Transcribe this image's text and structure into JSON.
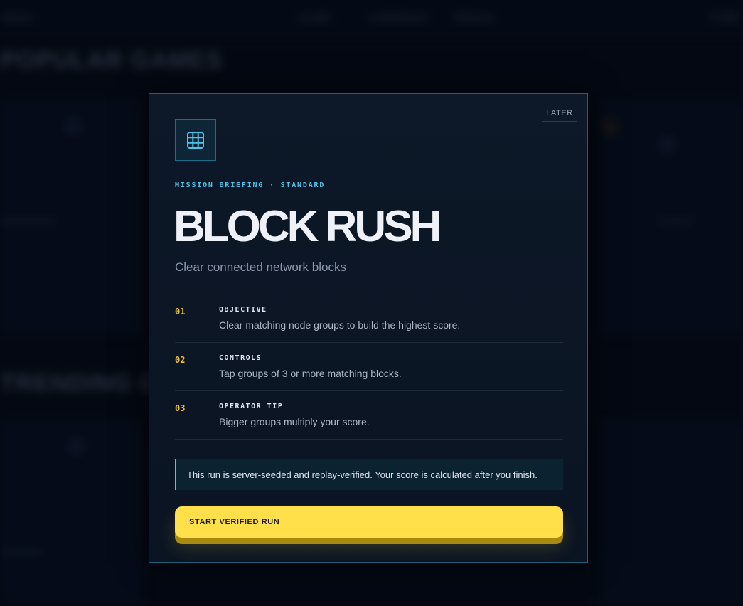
{
  "background": {
    "nav": [
      "Games",
      "Arcade",
      "Leaderboard",
      "Missions",
      "Profile"
    ],
    "sections": [
      "POPULAR GAMES",
      "TRENDING GAMES"
    ]
  },
  "modal": {
    "later_label": "LATER",
    "icon": "grid-icon",
    "eyebrow": "MISSION BRIEFING · STANDARD",
    "title": "BLOCK RUSH",
    "subtitle": "Clear connected network blocks",
    "steps": [
      {
        "num": "01",
        "label": "OBJECTIVE",
        "desc": "Clear matching node groups to build the highest score."
      },
      {
        "num": "02",
        "label": "CONTROLS",
        "desc": "Tap groups of 3 or more matching blocks."
      },
      {
        "num": "03",
        "label": "OPERATOR TIP",
        "desc": "Bigger groups multiply your score."
      }
    ],
    "notice": "This run is server-seeded and replay-verified. Your score is calculated after you finish.",
    "start_label": "START VERIFIED RUN"
  },
  "colors": {
    "accent_cyan": "#4fc3e8",
    "accent_yellow": "#ffe04a",
    "step_number": "#f2c230"
  }
}
